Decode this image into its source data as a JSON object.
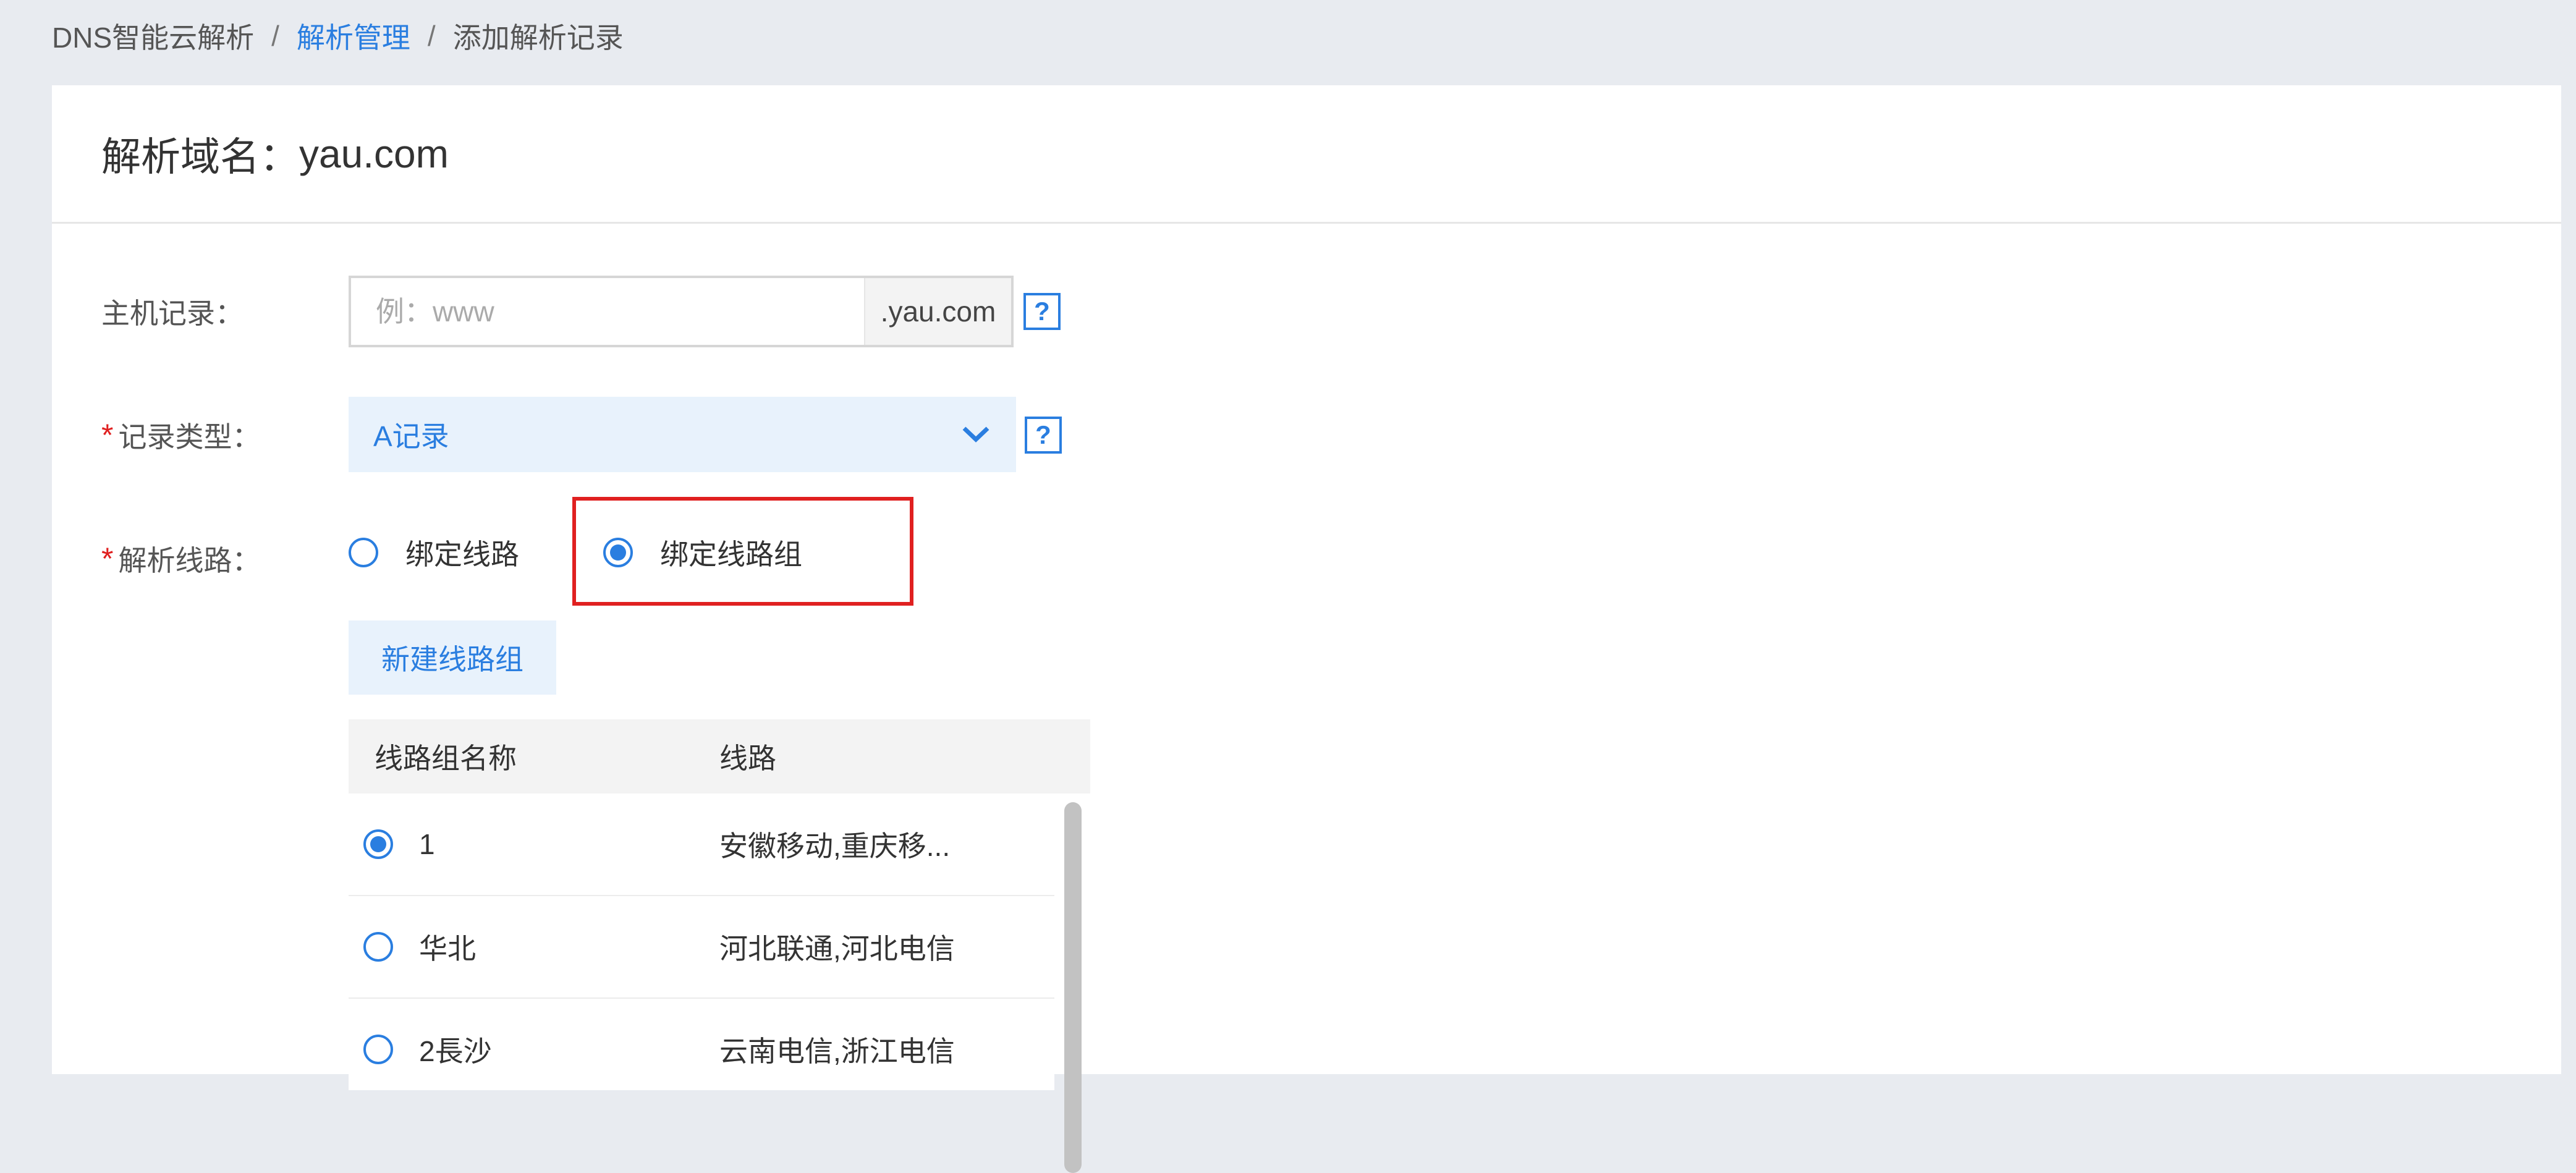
{
  "breadcrumb": {
    "root": "DNS智能云解析",
    "sep": "/",
    "manage": "解析管理",
    "current": "添加解析记录"
  },
  "domain_header": {
    "prefix": "解析域名：",
    "domain": "yau.com"
  },
  "host_record": {
    "label": "主机记录：",
    "placeholder": "例：www",
    "value": "",
    "suffix": ".yau.com",
    "help": "?"
  },
  "record_type": {
    "required_mark": "*",
    "label": "记录类型：",
    "selected": "A记录",
    "help": "?"
  },
  "resolve_line": {
    "required_mark": "*",
    "label": "解析线路：",
    "options": [
      {
        "label": "绑定线路",
        "selected": false
      },
      {
        "label": "绑定线路组",
        "selected": true
      }
    ],
    "new_group_button": "新建线路组"
  },
  "line_groups": {
    "columns": [
      "线路组名称",
      "线路"
    ],
    "rows": [
      {
        "name": "1",
        "lines": "安徽移动,重庆移...",
        "selected": true
      },
      {
        "name": "华北",
        "lines": "河北联通,河北电信",
        "selected": false
      },
      {
        "name": "2長沙",
        "lines": "云南电信,浙江电信",
        "selected": false
      }
    ]
  },
  "colors": {
    "accent": "#2a7ee0",
    "required": "#e02020",
    "highlight_box": "#e02020"
  },
  "icons": {
    "dropdown": "chevron-down-icon",
    "help": "question-icon"
  }
}
